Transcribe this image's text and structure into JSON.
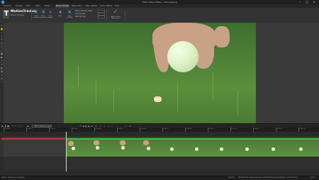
{
  "window": {
    "title": "VSDC Video Editor - 4 Processing"
  },
  "menu": {
    "tabs": [
      {
        "label": "Projects",
        "active": false
      },
      {
        "label": "Scenes",
        "active": false
      },
      {
        "label": "Edit",
        "active": false
      },
      {
        "label": "View",
        "active": false
      },
      {
        "label": "Editor",
        "active": false
      },
      {
        "label": "MotionTracker",
        "active": true
      },
      {
        "label": "Mask editor",
        "active": false
      },
      {
        "label": "Video effects",
        "active": false
      },
      {
        "label": "Audio effects",
        "active": false
      },
      {
        "label": "Tools",
        "active": false
      }
    ]
  },
  "ribbon": {
    "app_name": "MotionTracker",
    "app_subtitle": "Motion tracking",
    "buttons": [
      {
        "label": "Start tracking",
        "icon": "track-start-icon"
      },
      {
        "label": "Track backward",
        "icon": "track-backward-icon"
      },
      {
        "label": "Track forward",
        "icon": "track-forward-icon"
      },
      {
        "label": "Pause",
        "icon": "pause-icon"
      },
      {
        "label": "Stop tracking",
        "icon": "stop-icon"
      },
      {
        "label": "Remove tracking",
        "icon": "remove-icon"
      }
    ],
    "options": [
      {
        "label": "Motion tracking object",
        "value": ""
      },
      {
        "label": "Tracking area",
        "value": ""
      },
      {
        "label": "Tracking type",
        "value": ""
      }
    ],
    "apply_label": "Apply editing parameters"
  },
  "timeline": {
    "combo_value": "Motion tracking object",
    "ruler_labels": [
      "00:00:00",
      "00:00:01",
      "00:00:02",
      "00:00:03",
      "00:00:04",
      "00:00:05",
      "00:00:06",
      "00:00:07",
      "00:00:08",
      "00:00:09",
      "00:00:10",
      "00:00:11",
      "00:00:12",
      "00:00:13"
    ]
  },
  "status": {
    "left": "Motion tracking in progress",
    "pos_label": "Position:",
    "pos_value": "00:00:03.04",
    "start_label": "Start selection:",
    "start_value": "00:00:00.00",
    "end_label": "End selection:",
    "end_value": "00:00:13.00",
    "zoom": "100%"
  },
  "colors": {
    "accent": "#3fa9f5",
    "track_done": "#3fbf3f",
    "track_red": "#d13232",
    "apply": "#3fb950"
  }
}
